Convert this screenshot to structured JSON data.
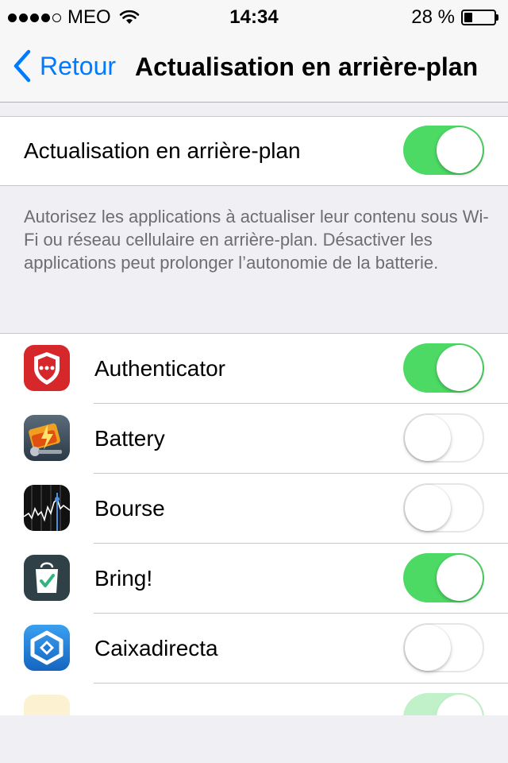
{
  "status_bar": {
    "carrier": "MEO",
    "time": "14:34",
    "battery_percent": "28 %",
    "battery_level": 0.28,
    "signal_bars": 4,
    "signal_total": 5
  },
  "nav": {
    "back_label": "Retour",
    "title": "Actualisation en arrière-plan"
  },
  "main_setting": {
    "label": "Actualisation en arrière-plan",
    "enabled": true
  },
  "description": "Autorisez les applications à actualiser leur contenu sous Wi-Fi ou réseau cellulaire en arrière-plan. Désactiver les applications peut prolonger l’autonomie de la batterie.",
  "apps": [
    {
      "name": "Authenticator",
      "enabled": true,
      "icon": "authenticator-icon"
    },
    {
      "name": "Battery",
      "enabled": false,
      "icon": "battery-app-icon"
    },
    {
      "name": "Bourse",
      "enabled": false,
      "icon": "stocks-icon"
    },
    {
      "name": "Bring!",
      "enabled": true,
      "icon": "bring-icon"
    },
    {
      "name": "Caixadirecta",
      "enabled": false,
      "icon": "caixadirecta-icon"
    }
  ],
  "colors": {
    "accent": "#007aff",
    "switch_on": "#4cd964",
    "background": "#efeff4"
  }
}
